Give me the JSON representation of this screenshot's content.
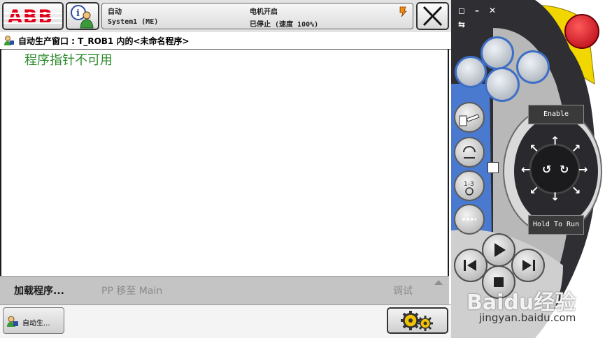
{
  "header": {
    "logo_text": "ABB",
    "status": {
      "mode": "自动",
      "system": "System1 (ME)",
      "motors": "电机开启",
      "run_state": "已停止 (速度 100%)"
    }
  },
  "window": {
    "title": "自动生产窗口 : T_ROB1 内的<未命名程序>"
  },
  "main": {
    "message": "程序指针不可用"
  },
  "commands": {
    "load_program": "加载程序...",
    "pp_to_main": "PP 移至 Main",
    "debug": "调试"
  },
  "taskbar": {
    "item_label": "自动生..."
  },
  "pendant": {
    "enable_label": "Enable",
    "hold_label": "Hold To Run"
  },
  "watermark": {
    "brand": "Baidu经验",
    "url": "jingyan.baidu.com"
  },
  "colors": {
    "abb_red": "#e2001a",
    "message_green": "#2e8b2e",
    "pendant_blue": "#3e6fc6",
    "emergency_red": "#d6101c",
    "enabling_yellow": "#f2d600"
  }
}
